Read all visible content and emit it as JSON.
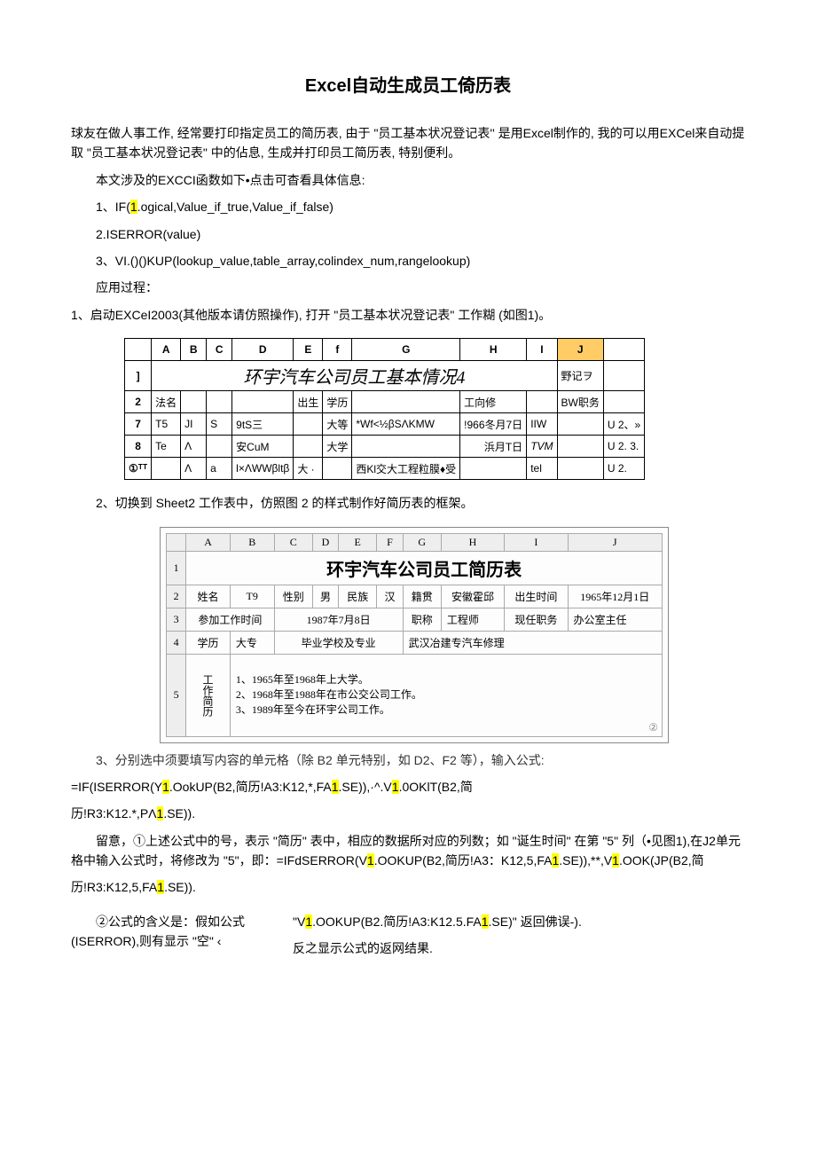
{
  "title": "Excel自动生成员工倚历表",
  "intro": "球友在做人事工作, 经常要打印指定员工的简历表, 由于 \"员工基本状况登记表'' 是用Excel制作的, 我的可以用EXCel来自动提取 \"员工基本状况登记表\" 中的佔息, 生成并打印员工简历表, 特别便利。",
  "func_intro": "本文涉及的EXCCI函数如下•点击可杳看具体信息:",
  "func1": "1、IF(",
  "func1_hl": "1",
  "func1_rest": ".ogical,Value_if_true,Value_if_false)",
  "func2": "2.ISERROR(value)",
  "func3": "3、VI.()()KUP(lookup_value,table_array,colindex_num,rangelookup)",
  "usage_title": "应用过程：",
  "step1": "1、启动EXCeI2003(其他版本请仿照操作), 打开 \"员工基本状况登记表\" 工作糊 (如图1)。",
  "table1": {
    "headers": [
      "",
      "A",
      "B",
      "C",
      "D",
      "E",
      "f",
      "G",
      "H",
      "I",
      "J"
    ],
    "title_row": {
      "main": "环宇汽车公司员工基本情况4",
      "sub": "野记ヲ"
    },
    "row2": [
      "2",
      "法名",
      "",
      "",
      "",
      "出生",
      "学历",
      "",
      "工向修",
      "",
      "BW职务",
      ""
    ],
    "row7": [
      "7",
      "T5",
      "JI",
      "S",
      "9tS三",
      "",
      "大等",
      "*Wf<½βSΛKMW",
      "!966冬月7日",
      "IIW",
      "",
      "U 2、»"
    ],
    "row8": [
      "8",
      "Te",
      "Λ",
      "",
      "安CuM",
      "",
      "大学",
      "",
      "浜月T日",
      "TVM",
      "",
      "U 2. 3."
    ],
    "row_last": [
      "①ᵀᵀ",
      "",
      "Λ",
      "a",
      "l×ΛWWβltβ",
      "大 ·",
      "",
      "西Kl交大工程粒膜♦受",
      "",
      "tel",
      "",
      "U 2."
    ]
  },
  "step2": "2、切换到 Sheet2 工作表中，仿照图 2 的样式制作好简历表的框架。",
  "table2": {
    "cols": [
      "",
      "A",
      "B",
      "C",
      "D",
      "E",
      "F",
      "G",
      "H",
      "I",
      "J"
    ],
    "title": "环宇汽车公司员工简历表",
    "row2": {
      "name_lbl": "姓名",
      "name_val": "T9",
      "sex_lbl": "性别",
      "sex_val": "男",
      "ethnic_lbl": "民族",
      "ethnic_val": "汉",
      "native_lbl": "籍贯",
      "native_val": "安徽霍邱",
      "birth_lbl": "出生时间",
      "birth_val": "1965年12月1日"
    },
    "row3": {
      "join_lbl": "参加工作时间",
      "join_val": "1987年7月8日",
      "title_lbl": "职称",
      "title_val": "工程师",
      "post_lbl": "现任职务",
      "post_val": "办公室主任"
    },
    "row4": {
      "edu_lbl": "学历",
      "edu_val": "大专",
      "school_lbl": "毕业学校及专业",
      "school_val": "武汉冶建专汽车修理"
    },
    "row5": {
      "history_lbl": "工作简历",
      "history_val": "1、1965年至1968年上大学。\n2、1968年至1988年在市公交公司工作。\n3、1989年至今在环宇公司工作。",
      "badge": "②"
    }
  },
  "step3_intro": "3、分别选中须要填写内容的单元格（除 B2 单元特别，如 D2、F2 等），输入公式:",
  "formula1_a": "=IF(ISERROR(Y",
  "formula1_b": ".OokUP(B2,简历!A3:K12,*,FA",
  "formula1_c": ".SE)),·^.V",
  "formula1_d": ".0OKlT(B2,简",
  "formula1_line2": "历!R3:K12.*,PΛ",
  "formula1_line2_end": ".SE)).",
  "note_intro": "留意，①上述公式中的号，表示 \"简历\" 表中，相应的数据所对应的列数；如 \"诞生时间\" 在第 \"5\" 列（•见图1),在J2单元格中输入公式时，将修改为 \"5\"，即：=IFdSERROR(V",
  "note_mid": ".OOKUP(B2,简历!A3：K12,5,FA",
  "note_mid2": ".SE)),**,V",
  "note_mid3": ".OOK(JP(B2,简",
  "note_line2": "历!R3:K12,5,FA",
  "note_line2_end": ".SE)).",
  "meaning_left": "②公式的含义是：假如公式(ISERROR),则有显示 \"空\" ‹",
  "meaning_right_a": "\"V",
  "meaning_right_b": ".OOKUP(B2.简历!A3:K12.5.FA",
  "meaning_right_c": ".SE)\" 返回佛误-).",
  "meaning_right_line2": "反之显示公式的返网结果."
}
